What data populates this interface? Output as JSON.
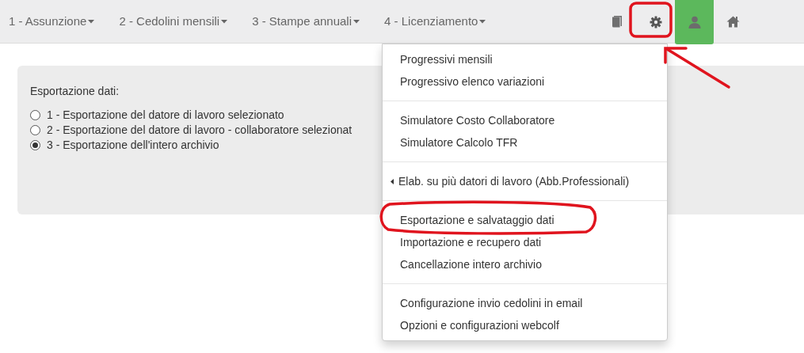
{
  "navbar": {
    "menus": [
      {
        "label": "1 - Assunzione"
      },
      {
        "label": "2 - Cedolini mensili"
      },
      {
        "label": "3 - Stampe annuali"
      },
      {
        "label": "4 - Licenziamento"
      }
    ],
    "icons": [
      {
        "kind": "book",
        "selected": false
      },
      {
        "kind": "gear",
        "selected": false
      },
      {
        "kind": "user",
        "selected": true
      },
      {
        "kind": "home",
        "selected": false
      }
    ]
  },
  "panel": {
    "title": "Esportazione dati:",
    "options": [
      {
        "label": "1 - Esportazione del datore di lavoro selezionato",
        "selected": false
      },
      {
        "label": "2 - Esportazione del datore di lavoro - collaboratore selezionat",
        "selected": false
      },
      {
        "label": "3 - Esportazione dell'intero archivio",
        "selected": true
      }
    ]
  },
  "dropdown": {
    "groups": [
      [
        {
          "label": "Progressivi mensili",
          "kind": "item"
        },
        {
          "label": "Progressivo elenco variazioni",
          "kind": "item"
        }
      ],
      [
        {
          "label": "Simulatore Costo Collaboratore",
          "kind": "item"
        },
        {
          "label": "Simulatore Calcolo TFR",
          "kind": "item"
        }
      ],
      [
        {
          "label": "Elab. su più datori di lavoro (Abb.Professionali)",
          "kind": "submenu"
        }
      ],
      [
        {
          "label": "Esportazione e salvataggio dati",
          "kind": "item"
        },
        {
          "label": "Importazione e recupero dati",
          "kind": "item"
        },
        {
          "label": "Cancellazione intero archivio",
          "kind": "item"
        }
      ],
      [
        {
          "label": "Configurazione invio cedolini in email",
          "kind": "item"
        },
        {
          "label": "Opzioni e configurazioni webcolf",
          "kind": "item"
        }
      ]
    ]
  },
  "annotations": [
    {
      "kind": "rectangle"
    },
    {
      "kind": "arrow"
    },
    {
      "kind": "ellipse"
    }
  ]
}
